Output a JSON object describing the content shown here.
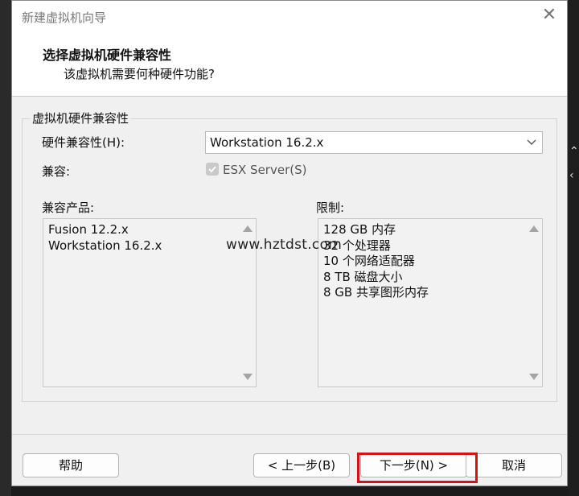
{
  "window": {
    "title": "新建虚拟机向导"
  },
  "header": {
    "title": "选择虚拟机硬件兼容性",
    "subtitle": "该虚拟机需要何种硬件功能?"
  },
  "group": {
    "legend": "虚拟机硬件兼容性",
    "hardware_label": "硬件兼容性(H):",
    "hardware_value": "Workstation 16.2.x",
    "compat_label": "兼容:",
    "esx_label": "ESX Server(S)",
    "products_label": "兼容产品:",
    "products": [
      "Fusion 12.2.x",
      "Workstation 16.2.x"
    ],
    "limits_label": "限制:",
    "limits": [
      "128 GB 内存",
      "32 个处理器",
      "10 个网络适配器",
      "8 TB 磁盘大小",
      "8 GB 共享图形内存"
    ]
  },
  "watermark": "www.hztdst.com",
  "buttons": {
    "help": "帮助",
    "back": "< 上一步(B)",
    "next": "下一步(N) >",
    "cancel": "取消"
  },
  "colors": {
    "highlight": "#d41414",
    "dialog_bg": "#f0f0f0"
  }
}
